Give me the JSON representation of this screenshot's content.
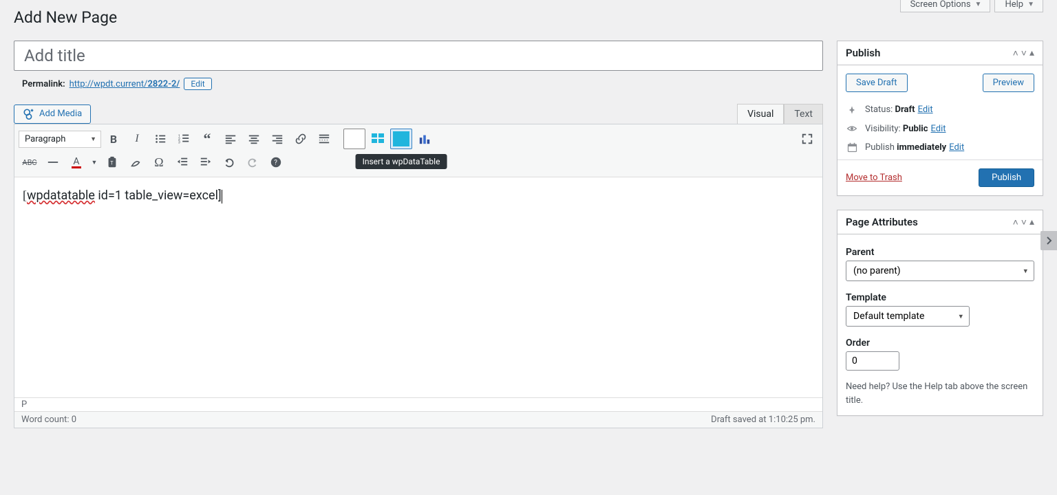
{
  "topbar": {
    "screen_options": "Screen Options",
    "help": "Help"
  },
  "page_heading": "Add New Page",
  "title_placeholder": "Add title",
  "permalink": {
    "label": "Permalink:",
    "base": "http://wpdt.current/",
    "slug": "2822-2/",
    "edit": "Edit"
  },
  "add_media": "Add Media",
  "tabs": {
    "visual": "Visual",
    "text": "Text"
  },
  "format_select": "Paragraph",
  "tooltip": "Insert a wpDataTable",
  "editor_content": {
    "word": "wpdatatable",
    "rest": " id=1 table_view=excel]"
  },
  "status_path": "P",
  "word_count": "Word count: 0",
  "draft_saved": "Draft saved at 1:10:25 pm.",
  "publish_box": {
    "title": "Publish",
    "save_draft": "Save Draft",
    "preview": "Preview",
    "status_label": "Status: ",
    "status_value": "Draft",
    "status_edit": "Edit",
    "visibility_label": "Visibility: ",
    "visibility_value": "Public",
    "visibility_edit": "Edit",
    "schedule_label": "Publish ",
    "schedule_value": "immediately",
    "schedule_edit": "Edit",
    "trash": "Move to Trash",
    "publish": "Publish"
  },
  "attributes_box": {
    "title": "Page Attributes",
    "parent_label": "Parent",
    "parent_value": "(no parent)",
    "template_label": "Template",
    "template_value": "Default template",
    "order_label": "Order",
    "order_value": "0",
    "help": "Need help? Use the Help tab above the screen title."
  }
}
